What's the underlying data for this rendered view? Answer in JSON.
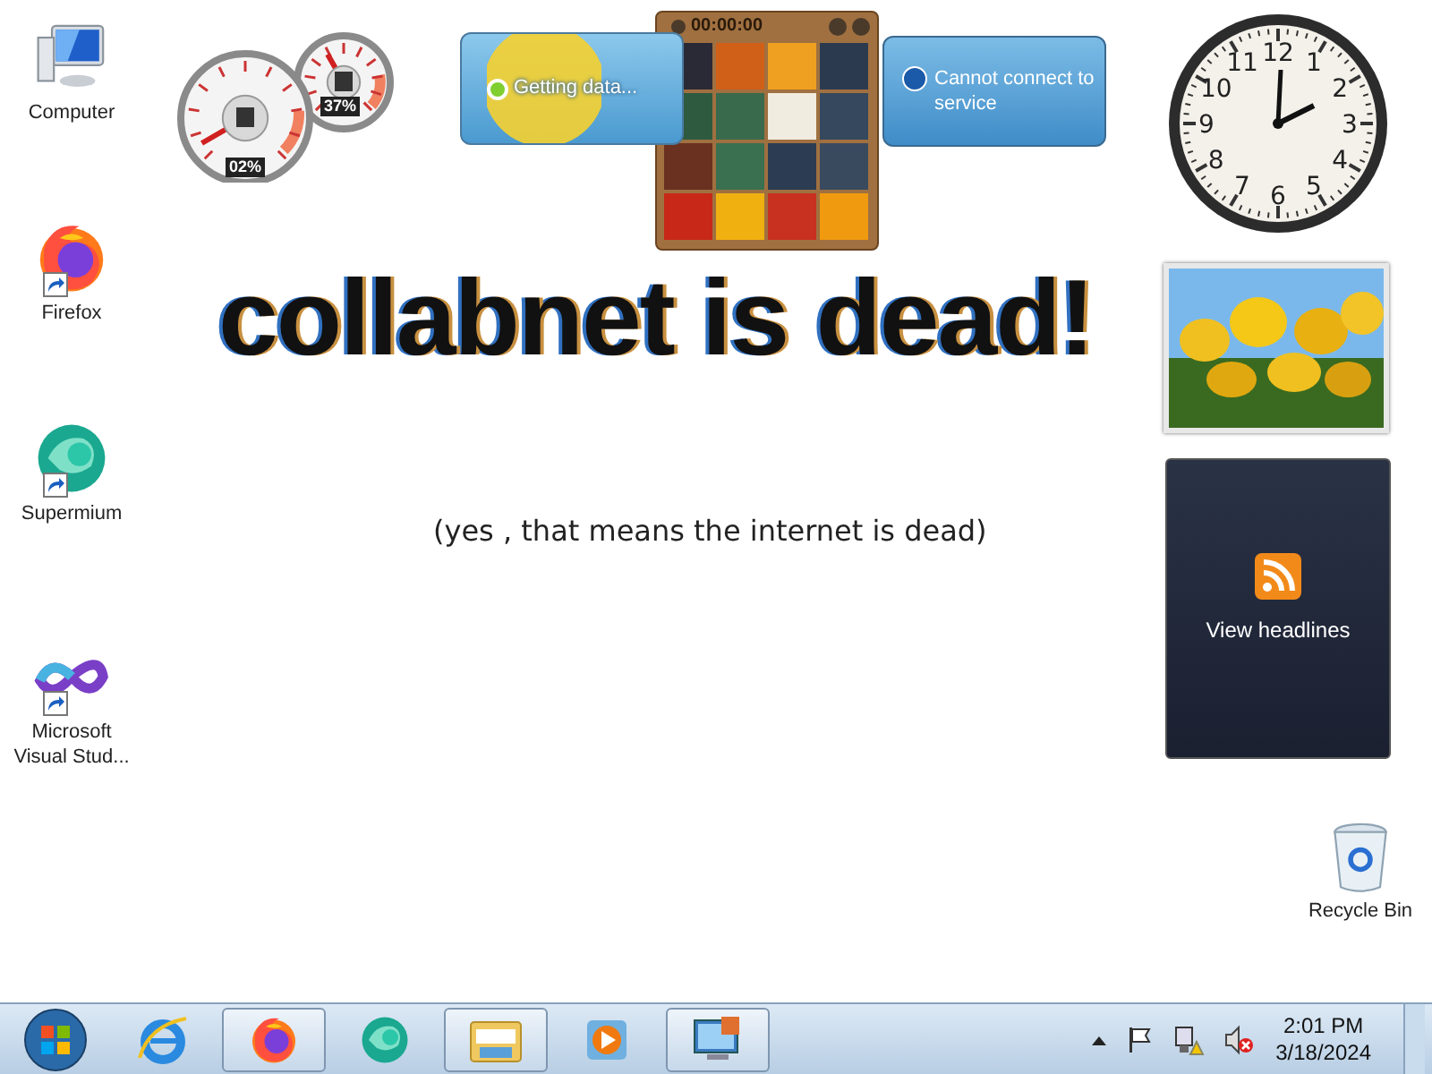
{
  "desktop_icons": [
    {
      "kind": "computer",
      "label": "Computer"
    },
    {
      "kind": "firefox",
      "label": "Firefox"
    },
    {
      "kind": "supermium",
      "label": "Supermium"
    },
    {
      "kind": "visualstudio",
      "label": "Microsoft Visual Stud..."
    },
    {
      "kind": "recyclebin",
      "label": "Recycle Bin"
    }
  ],
  "wallpaper": {
    "headline": "collabnet is dead!",
    "subtitle": "(yes , that means the internet is dead)"
  },
  "gadgets": {
    "cpu_meter": {
      "cpu": "02%",
      "memory": "37%"
    },
    "weather": {
      "status": "Getting data..."
    },
    "puzzle": {
      "timer": "00:00:00"
    },
    "stocks": {
      "message": "Cannot connect to service"
    },
    "clock": {
      "numerals": [
        "12",
        "11",
        "1",
        "10",
        "2",
        "9",
        "3",
        "8",
        "4",
        "7",
        "5",
        "6"
      ]
    },
    "feed": {
      "label": "View headlines"
    }
  },
  "taskbar": {
    "buttons": [
      {
        "kind": "start",
        "running": false
      },
      {
        "kind": "ie",
        "running": false
      },
      {
        "kind": "firefox",
        "running": true
      },
      {
        "kind": "supermium",
        "running": false
      },
      {
        "kind": "explorer",
        "running": true
      },
      {
        "kind": "mediaplayer",
        "running": false
      },
      {
        "kind": "remotedesktop",
        "running": true
      }
    ],
    "tray": [
      {
        "kind": "chevron"
      },
      {
        "kind": "flag"
      },
      {
        "kind": "network"
      },
      {
        "kind": "volume-muted"
      }
    ],
    "time": "2:01 PM",
    "date": "3/18/2024"
  }
}
